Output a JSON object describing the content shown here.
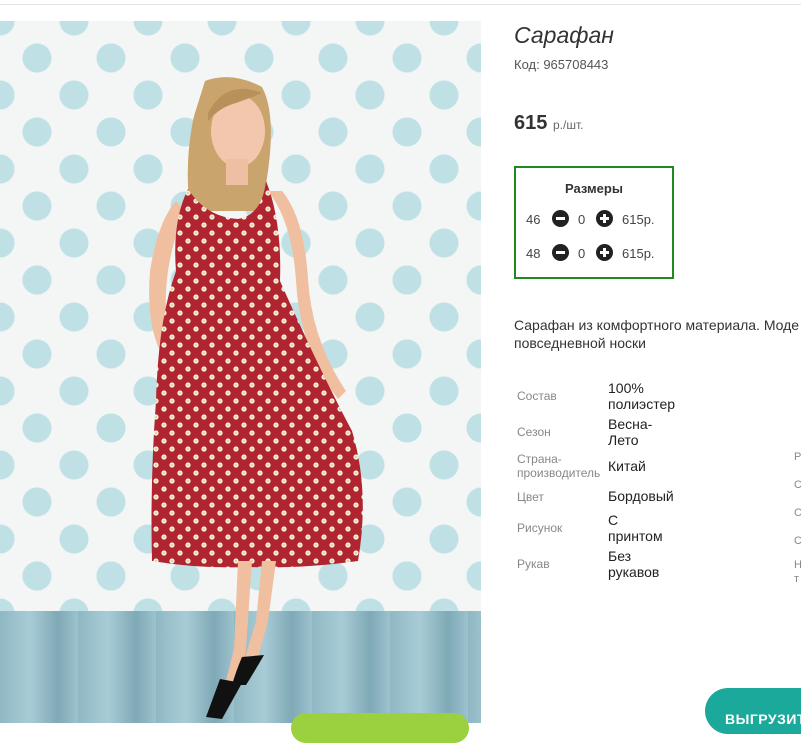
{
  "product": {
    "title": "Сарафан",
    "code": "Код: 965708443",
    "price": "615",
    "price_unit": "р./шт."
  },
  "sizes": {
    "title": "Размеры",
    "rows": [
      {
        "size": "46",
        "qty": "0",
        "price": "615р."
      },
      {
        "size": "48",
        "qty": "0",
        "price": "615р."
      }
    ]
  },
  "description": {
    "line1": "Сарафан из комфортного материала. Моде",
    "line2": "повседневной носки"
  },
  "attributes": [
    {
      "label": "Состав",
      "value": "100%\nполиэстер"
    },
    {
      "label": "Сезон",
      "value": "Весна-\nЛето"
    },
    {
      "label": "Страна-\nпроизводитель",
      "value": "Китай"
    },
    {
      "label": "Цвет",
      "value": "Бордовый"
    },
    {
      "label": "Рисунок",
      "value": "С\nпринтом"
    },
    {
      "label": "Рукав",
      "value": "Без\nрукавов"
    }
  ],
  "edge_letters": [
    "Р",
    "С",
    "С",
    "С",
    "Н",
    "т"
  ],
  "export_button": "ВЫГРУЗИТ",
  "colors": {
    "sizes_border": "#1f8a1f",
    "export_button": "#1aa99a",
    "green_button": "#9bd13f",
    "dress": "#b0252f"
  },
  "icons": [
    "minus-circle-icon",
    "plus-circle-icon"
  ]
}
